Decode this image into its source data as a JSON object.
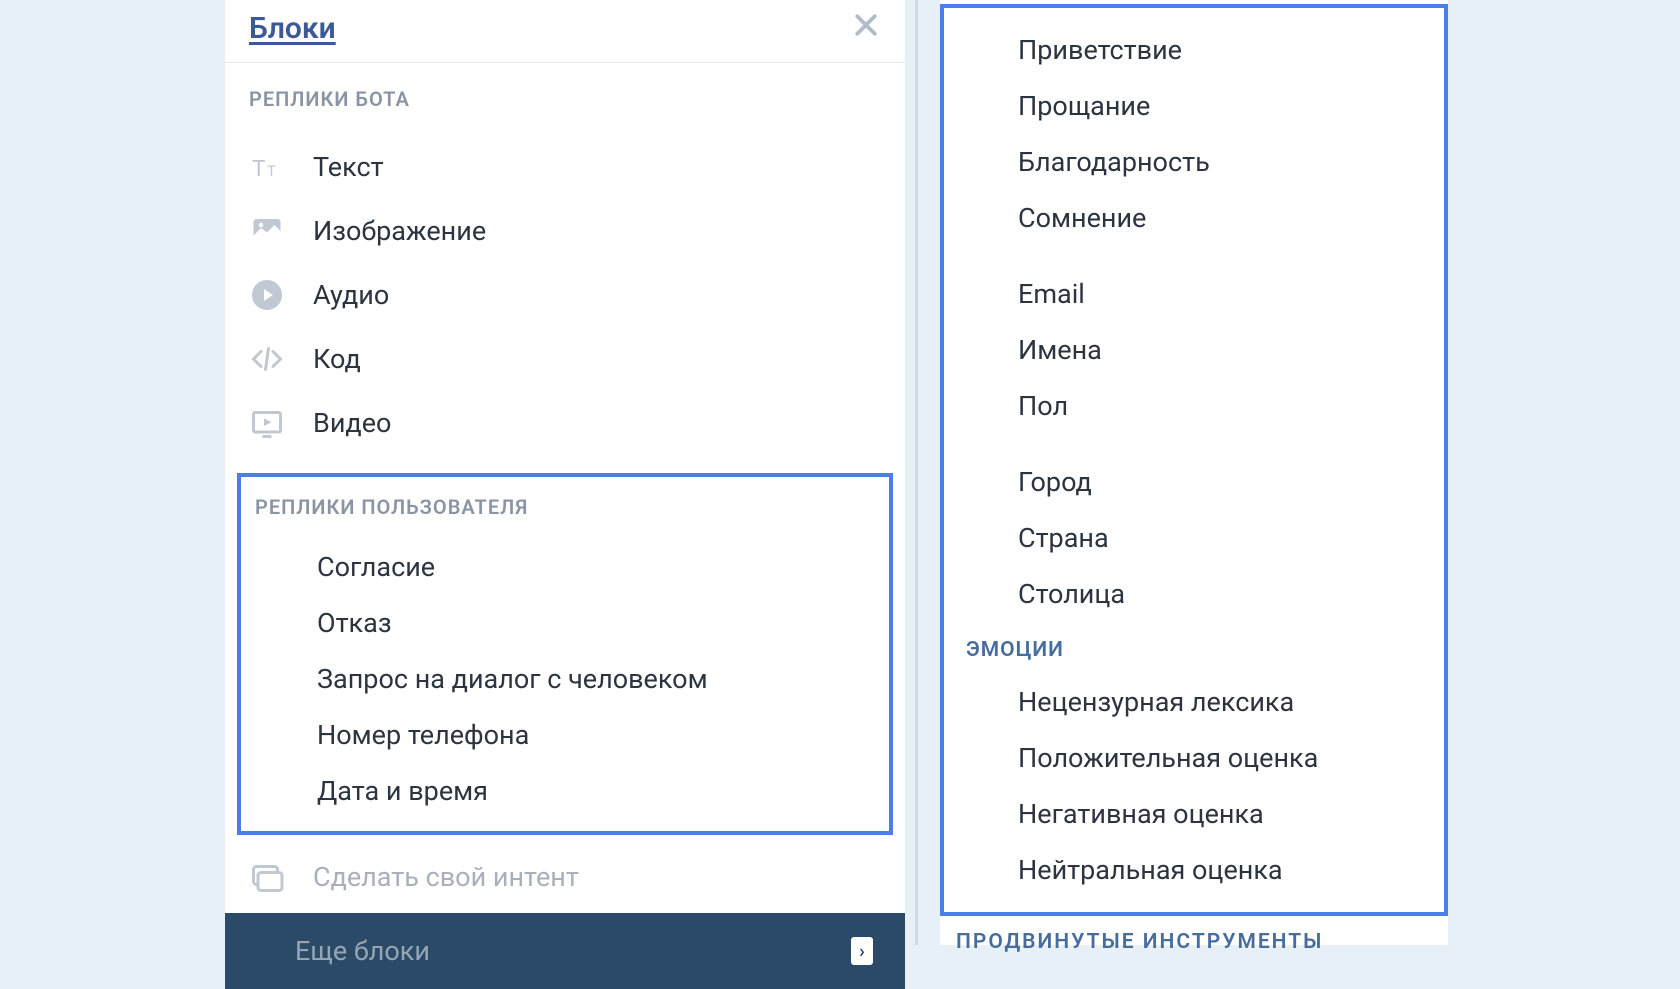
{
  "panel": {
    "title": "Блоки"
  },
  "sections": {
    "bot_replies": {
      "header": "РЕПЛИКИ БОТА",
      "items": [
        {
          "icon": "text-icon",
          "label": "Текст"
        },
        {
          "icon": "image-icon",
          "label": "Изображение"
        },
        {
          "icon": "audio-icon",
          "label": "Аудио"
        },
        {
          "icon": "code-icon",
          "label": "Код"
        },
        {
          "icon": "video-icon",
          "label": "Видео"
        }
      ]
    },
    "user_replies": {
      "header": "РЕПЛИКИ ПОЛЬЗОВАТЕЛЯ",
      "items": [
        "Согласие",
        "Отказ",
        "Запрос на диалог с человеком",
        "Номер телефона",
        "Дата и время"
      ]
    },
    "custom_intent": "Сделать свой интент",
    "more_blocks": "Еще блоки"
  },
  "right": {
    "group_a": [
      "Приветствие",
      "Прощание",
      "Благодарность",
      "Сомнение"
    ],
    "group_b": [
      "Email",
      "Имена",
      "Пол"
    ],
    "group_c": [
      "Город",
      "Страна",
      "Столица"
    ],
    "emotions_header": "ЭМОЦИИ",
    "emotions": [
      "Нецензурная лексика",
      "Положительная оценка",
      "Негативная оценка",
      "Нейтральная оценка"
    ],
    "advanced_header": "ПРОДВИНУТЫЕ ИНСТРУМЕНТЫ"
  }
}
